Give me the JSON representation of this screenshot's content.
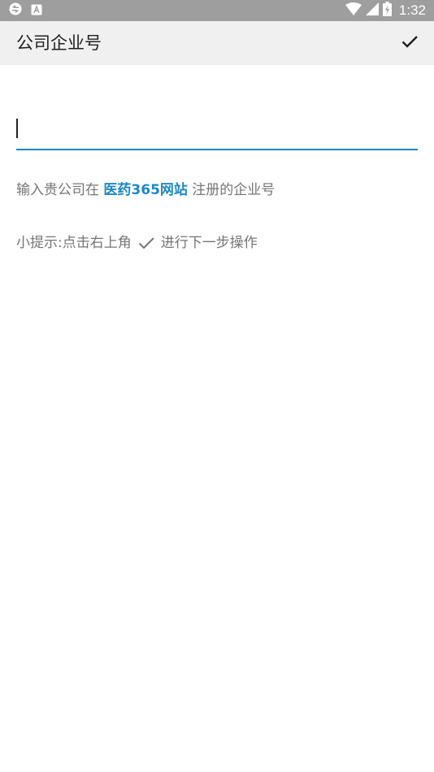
{
  "status_bar": {
    "time": "1:32",
    "icons": [
      "sync-icon",
      "keyboard-a-icon",
      "wifi-icon",
      "signal-icon",
      "battery-charging-icon"
    ]
  },
  "app_bar": {
    "title": "公司企业号",
    "confirm_icon": "check-icon"
  },
  "form": {
    "company_id_value": "",
    "company_id_placeholder": ""
  },
  "hints": {
    "instruction_prefix": "输入贵公司在 ",
    "site_name": "医药365网站",
    "instruction_suffix": " 注册的企业号",
    "tip_prefix": "小提示:点击右上角",
    "tip_suffix": "进行下一步操作"
  },
  "colors": {
    "accent": "#1e88c7",
    "status_bar": "#9e9e9e",
    "app_bar": "#f0f0f0",
    "hint_text": "#757575"
  }
}
